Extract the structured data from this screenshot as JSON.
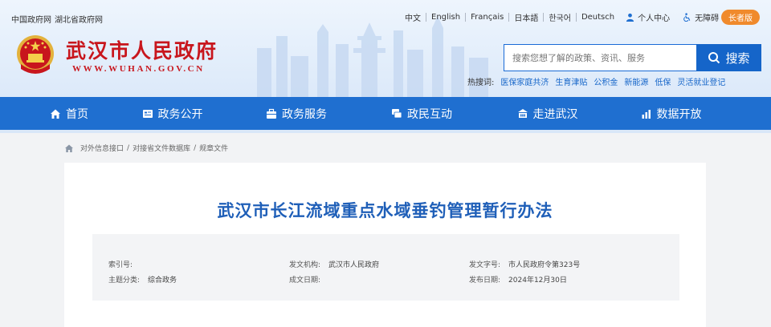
{
  "top_links": [
    "中国政府网",
    "湖北省政府网"
  ],
  "languages": [
    "中文",
    "English",
    "Français",
    "日本語",
    "한국어",
    "Deutsch"
  ],
  "utilities": {
    "personal_center": "个人中心",
    "accessibility": "无障碍"
  },
  "elder_button": "长者版",
  "site": {
    "title": "武汉市人民政府",
    "url_prefix": "WWW.",
    "url_highlight": "WUHAN",
    "url_suffix": ".GOV.CN"
  },
  "search": {
    "placeholder": "搜索您想了解的政策、资讯、服务",
    "button": "搜索"
  },
  "hot_words": {
    "label": "热搜词:",
    "items": [
      "医保家庭共济",
      "生育津贴",
      "公积金",
      "新能源",
      "低保",
      "灵活就业登记"
    ]
  },
  "nav": [
    {
      "label": "首页",
      "icon": "home-icon"
    },
    {
      "label": "政务公开",
      "icon": "list-icon"
    },
    {
      "label": "政务服务",
      "icon": "service-icon"
    },
    {
      "label": "政民互动",
      "icon": "interaction-icon"
    },
    {
      "label": "走进武汉",
      "icon": "building-icon"
    },
    {
      "label": "数据开放",
      "icon": "chart-icon"
    }
  ],
  "breadcrumb": [
    "对外信息接口",
    "对接省文件数据库",
    "规章文件"
  ],
  "document": {
    "title": "武汉市长江流域重点水域垂钓管理暂行办法",
    "meta": {
      "index_label": "索引号:",
      "index_value": "",
      "topic_label": "主题分类:",
      "topic_value": "综合政务",
      "issuer_label": "发文机构:",
      "issuer_value": "武汉市人民政府",
      "created_label": "成文日期:",
      "created_value": "",
      "docno_label": "发文字号:",
      "docno_value": "市人民政府令第323号",
      "pubdate_label": "发布日期:",
      "pubdate_value": "2024年12月30日"
    }
  },
  "colors": {
    "brand_red": "#c8161d",
    "nav_blue": "#1f6fd0",
    "title_blue": "#1f5fb8",
    "elder_orange": "#f08a2c"
  }
}
